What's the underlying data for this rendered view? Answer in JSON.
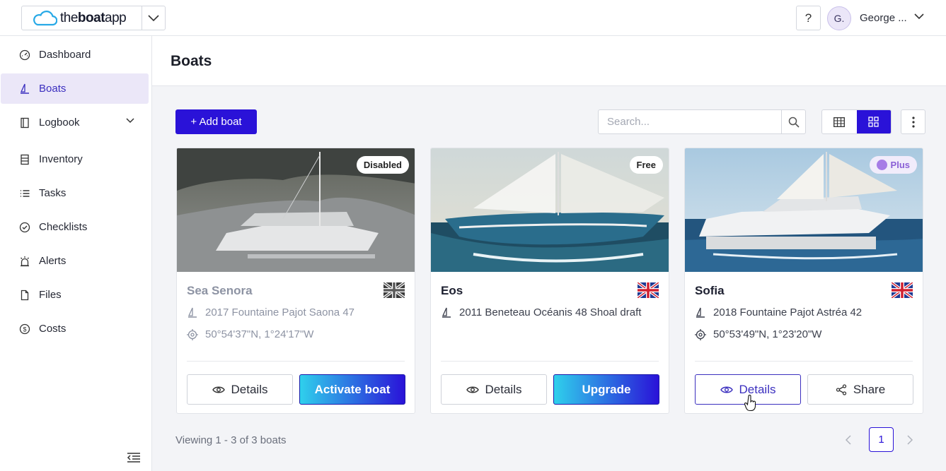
{
  "brand": {
    "name_light": "the",
    "name_bold": "boat",
    "name_rest": "app"
  },
  "header": {
    "help_label": "?",
    "avatar_initial": "G.",
    "user_name": "George ..."
  },
  "sidebar": {
    "items": [
      {
        "label": "Dashboard",
        "icon": "dashboard-icon"
      },
      {
        "label": "Boats",
        "icon": "sailboat-icon",
        "active": true
      },
      {
        "label": "Logbook",
        "icon": "book-icon",
        "expandable": true
      },
      {
        "label": "Inventory",
        "icon": "inventory-icon"
      },
      {
        "label": "Tasks",
        "icon": "tasks-icon"
      },
      {
        "label": "Checklists",
        "icon": "check-circle-icon"
      },
      {
        "label": "Alerts",
        "icon": "alarm-icon"
      },
      {
        "label": "Files",
        "icon": "file-icon"
      },
      {
        "label": "Costs",
        "icon": "dollar-icon"
      }
    ]
  },
  "page": {
    "title": "Boats"
  },
  "toolbar": {
    "add_label": "+ Add boat",
    "search_placeholder": "Search...",
    "view_mode": "grid"
  },
  "boats": [
    {
      "name": "Sea Senora",
      "badge": "Disabled",
      "model": "2017 Fountaine Pajot Saona 47",
      "position": "50°54'37\"N, 1°24'17\"W",
      "flag": "uk-flag-grayscale",
      "primary_label": "Details",
      "secondary_label": "Activate boat"
    },
    {
      "name": "Eos",
      "badge": "Free",
      "model": "2011 Beneteau Océanis 48 Shoal draft",
      "position": "",
      "flag": "uk-flag",
      "primary_label": "Details",
      "secondary_label": "Upgrade"
    },
    {
      "name": "Sofia",
      "badge": "Plus",
      "model": "2018 Fountaine Pajot Astréa 42",
      "position": "50°53'49\"N, 1°23'20\"W",
      "flag": "uk-flag",
      "primary_label": "Details",
      "secondary_label": "Share"
    }
  ],
  "footer": {
    "viewing_text": "Viewing 1 - 3 of 3 boats",
    "current_page": "1"
  },
  "colors": {
    "accent": "#2a12d8",
    "active_bg": "#ebe7f8",
    "plus_badge": "#8a5fd6",
    "gradient_start": "#2fd0ec"
  }
}
